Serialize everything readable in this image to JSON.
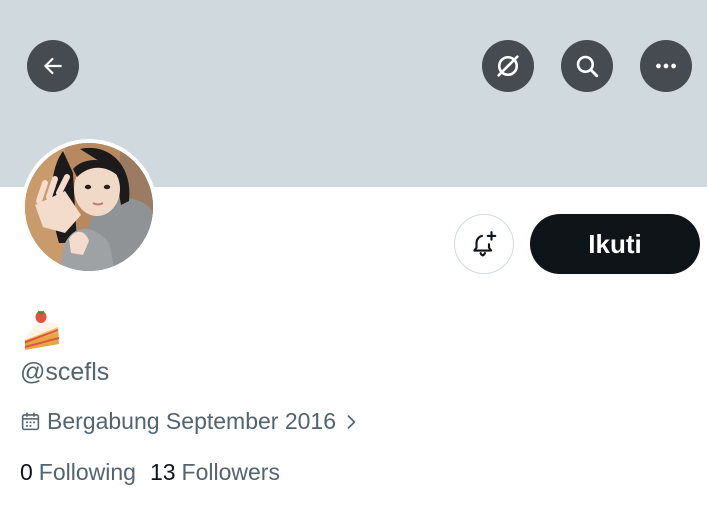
{
  "colors": {
    "banner": "#cfd9de",
    "follow_button_bg": "#0f1419",
    "secondary_text": "#536471"
  },
  "header": {
    "back_icon": "arrow-left-icon",
    "grok_icon": "grok-icon",
    "search_icon": "search-icon",
    "more_icon": "more-horizontal-icon"
  },
  "profile": {
    "bio_emoji": "🍰",
    "handle": "@scefls",
    "joined_text": "Bergabung September 2016",
    "following_count": "0",
    "following_label": "Following",
    "followers_count": "13",
    "followers_label": "Followers"
  },
  "actions": {
    "notify_icon": "bell-plus-icon",
    "follow_label": "Ikuti"
  }
}
